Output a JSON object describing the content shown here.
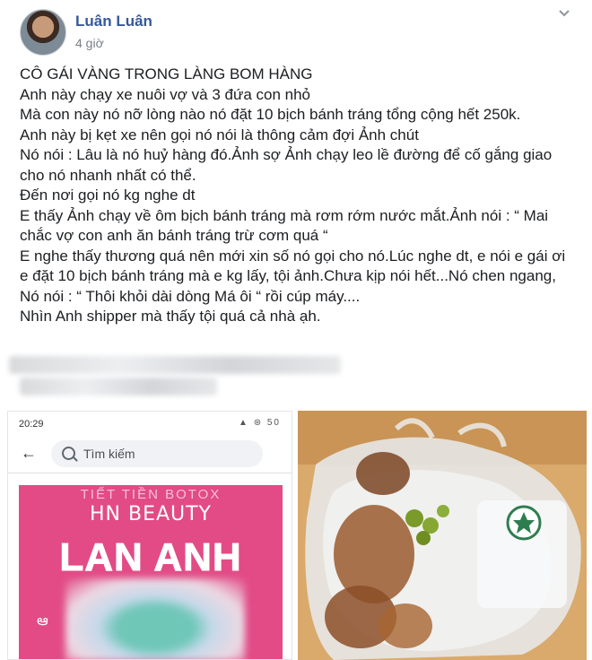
{
  "post": {
    "author": "Luân Luân",
    "time": "4 giờ",
    "lines": [
      "CÔ GÁI VÀNG TRONG LÀNG BOM HÀNG",
      "Anh này chạy xe nuôi vợ và 3 đứa con nhỏ",
      "Mà con này nó nỡ lòng nào nó đặt 10 bịch bánh tráng tổng cộng hết 250k.",
      "Anh này bị kẹt xe nên gọi nó nói là thông cảm đợi Ảnh chút",
      "Nó nói : Lâu là nó huỷ hàng đó.Ảnh sợ Ảnh chạy leo lề đường để cố gắng giao cho nó nhanh nhất có thể.",
      "Đến nơi gọi nó kg nghe dt",
      "E thấy Ảnh chạy về ôm bịch bánh tráng mà rơm rớm nước mắt.Ảnh nói : “ Mai chắc vợ con anh ăn bánh tráng trừ cơm quá “",
      "E nghe thấy thương quá nên mới xin số nó gọi cho nó.Lúc nghe dt, e nói e gái ơi e đặt 10 bịch bánh tráng mà e kg lấy, tội ảnh.Chưa kịp nói hết...Nó chen ngang, Nó nói : “ Thôi khỏi dài dòng Má ôi “ rồi cúp máy....",
      "Nhìn Anh shipper mà thấy tội quá cả nhà ạh."
    ]
  },
  "screenshot": {
    "status_time": "20:29",
    "status_icons": "▲ ⊛ 50",
    "search_placeholder": "Tìm kiếm",
    "cover_top": "TIẾT TIỀN BOTOX",
    "cover_brand": "HN BEAUTY",
    "cover_name": "LAN ANH"
  },
  "colors": {
    "author": "#365899",
    "cover_pink": "#e24b86"
  }
}
